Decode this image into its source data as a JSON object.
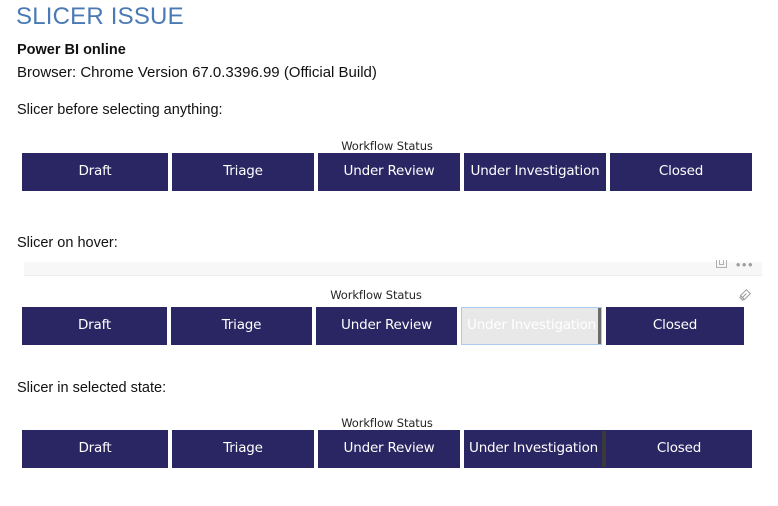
{
  "document": {
    "title": "SLICER ISSUE",
    "subtitle": "Power BI online",
    "browser_line": "Browser: Chrome Version 67.0.3396.99 (Official Build)"
  },
  "sections": {
    "default": {
      "caption": "Slicer before selecting anything:",
      "slicer_title": "Workflow Status",
      "tiles": [
        {
          "label": "Draft",
          "state": "normal"
        },
        {
          "label": "Triage",
          "state": "normal"
        },
        {
          "label": "Under Review",
          "state": "normal"
        },
        {
          "label": "Under Investigation",
          "state": "normal"
        },
        {
          "label": "Closed",
          "state": "normal"
        }
      ]
    },
    "hover": {
      "caption": "Slicer on hover:",
      "slicer_title": "Workflow Status",
      "tiles": [
        {
          "label": "Draft",
          "state": "normal"
        },
        {
          "label": "Triage",
          "state": "normal"
        },
        {
          "label": "Under Review",
          "state": "normal"
        },
        {
          "label": "Under Investigation",
          "state": "hovered"
        },
        {
          "label": "Closed",
          "state": "normal"
        }
      ],
      "icons": {
        "focus_mode": "focus-mode-icon",
        "more_options": "more-options-icon",
        "clear_selections": "eraser-icon",
        "more_options_glyph": "•••"
      }
    },
    "selected": {
      "caption": "Slicer in selected state:",
      "slicer_title": "Workflow Status",
      "tiles": [
        {
          "label": "Draft",
          "state": "normal"
        },
        {
          "label": "Triage",
          "state": "normal"
        },
        {
          "label": "Under Review",
          "state": "normal"
        },
        {
          "label": "Under Investigation",
          "state": "selected"
        },
        {
          "label": "Closed",
          "state": "normal"
        }
      ]
    }
  },
  "colors": {
    "heading_blue": "#4a7ab5",
    "slicer_navy": "#2a2563",
    "hover_fill": "#e8e8e8",
    "hover_border": "#a9cbef",
    "page_background": "#ffffff",
    "panel_header": "#f7f7f7",
    "selected_divider": "#3a3a3a"
  }
}
